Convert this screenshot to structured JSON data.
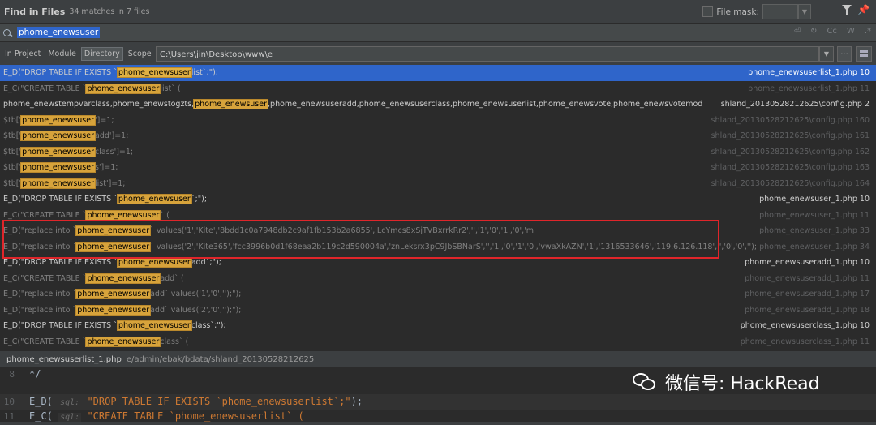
{
  "header": {
    "title": "Find in Files",
    "matches": "34 matches in 7 files",
    "file_mask_label": "File mask:"
  },
  "search": {
    "query": "phome_enewsuser",
    "tools": [
      "⏎",
      "↻",
      "Cc",
      "W",
      ".*"
    ]
  },
  "scope": {
    "tabs": [
      "In Project",
      "Module",
      "Directory",
      "Scope"
    ],
    "active_tab": "Directory",
    "path": "C:\\Users\\jin\\Desktop\\www\\e",
    "browse_label": "..."
  },
  "results": [
    {
      "pre": "E_D(\"DROP TABLE IF EXISTS `",
      "hl": "phome_enewsuser",
      "post": "list`;\");",
      "loc": "phome_enewsuserlist_1.php 10",
      "style": "selected"
    },
    {
      "pre": "E_C(\"CREATE TABLE `",
      "hl": "phome_enewsuser",
      "post": "list` (",
      "loc": "phome_enewsuserlist_1.php 11",
      "style": "other"
    },
    {
      "pre": "phome_enewstempvarclass,phome_enewstogzts,",
      "hl": "phome_enewsuser",
      "post": ",phome_enewsuseradd,phome_enewsuserclass,phome_enewsuserlist,phome_enewsvote,phome_enewsvotemod",
      "loc": "shland_20130528212625\\config.php 2",
      "style": "bright"
    },
    {
      "pre": "$tb['",
      "hl": "phome_enewsuser",
      "post": "']=1;",
      "loc": "shland_20130528212625\\config.php 160",
      "style": "other"
    },
    {
      "pre": "$tb['",
      "hl": "phome_enewsuser",
      "post": "add']=1;",
      "loc": "shland_20130528212625\\config.php 161",
      "style": "other"
    },
    {
      "pre": "$tb['",
      "hl": "phome_enewsuser",
      "post": "class']=1;",
      "loc": "shland_20130528212625\\config.php 162",
      "style": "other"
    },
    {
      "pre": "$tb['",
      "hl": "phome_enewsuser",
      "post": "s']=1;",
      "loc": "shland_20130528212625\\config.php 163",
      "style": "other"
    },
    {
      "pre": "$tb['",
      "hl": "phome_enewsuser",
      "post": "list']=1;",
      "loc": "shland_20130528212625\\config.php 164",
      "style": "other"
    },
    {
      "pre": "E_D(\"DROP TABLE IF EXISTS `",
      "hl": "phome_enewsuser",
      "post": "`;\");",
      "loc": "phome_enewsuser_1.php 10",
      "style": "bright"
    },
    {
      "pre": "E_C(\"CREATE TABLE `",
      "hl": "phome_enewsuser",
      "post": "` (",
      "loc": "phome_enewsuser_1.php 11",
      "style": "other"
    },
    {
      "pre": "E_D(\"replace into `",
      "hl": "phome_enewsuser",
      "post": "` values('1','Kite','8bdd1c0a7948db2c9af1fb153b2a6855','LcYmcs8xSjTVBxrrkRr2','','1','0','1','0','m",
      "loc": "phome_enewsuser_1.php 33",
      "style": "other"
    },
    {
      "pre": "E_D(\"replace into `",
      "hl": "phome_enewsuser",
      "post": "` values('2','Kite365','fcc3996b0d1f68eaa2b119c2d590004a','znLeksrx3pC9JbSBNarS','','1','0','1','0','vwaXkAZN','1','1316533646','119.6.126.118','','0','0','');\");",
      "loc": "phome_enewsuser_1.php 34",
      "style": "other"
    },
    {
      "pre": "E_D(\"DROP TABLE IF EXISTS `",
      "hl": "phome_enewsuser",
      "post": "add`;\");",
      "loc": "phome_enewsuseradd_1.php 10",
      "style": "bright"
    },
    {
      "pre": "E_C(\"CREATE TABLE `",
      "hl": "phome_enewsuser",
      "post": "add` (",
      "loc": "phome_enewsuseradd_1.php 11",
      "style": "other"
    },
    {
      "pre": "E_D(\"replace into `",
      "hl": "phome_enewsuser",
      "post": "add` values('1','0','');\");",
      "loc": "phome_enewsuseradd_1.php 17",
      "style": "other"
    },
    {
      "pre": "E_D(\"replace into `",
      "hl": "phome_enewsuser",
      "post": "add` values('2','0','');\");",
      "loc": "phome_enewsuseradd_1.php 18",
      "style": "other"
    },
    {
      "pre": "E_D(\"DROP TABLE IF EXISTS `",
      "hl": "phome_enewsuser",
      "post": "class`;\");",
      "loc": "phome_enewsuserclass_1.php 10",
      "style": "bright"
    },
    {
      "pre": "E_C(\"CREATE TABLE `",
      "hl": "phome_enewsuser",
      "post": "class` (",
      "loc": "phome_enewsuserclass_1.php 11",
      "style": "other"
    }
  ],
  "status": {
    "file": "phome_enewsuserlist_1.php",
    "path": "e/admin/ebak/bdata/shland_20130528212625"
  },
  "preview": {
    "lines": [
      {
        "num": "8",
        "code": "*/"
      },
      {
        "num": "",
        "code": ""
      },
      {
        "num": "10",
        "pre": "E_D( ",
        "sql": "sql:",
        "str": "\"DROP TABLE IF EXISTS `phome_enewsuserlist`;\"",
        "post": ");"
      },
      {
        "num": "11",
        "pre": "E_C( ",
        "sql": "sql:",
        "str": "\"CREATE TABLE `phome_enewsuserlist` (",
        "post": ""
      }
    ]
  },
  "watermark": {
    "text": "微信号: HackRead"
  }
}
